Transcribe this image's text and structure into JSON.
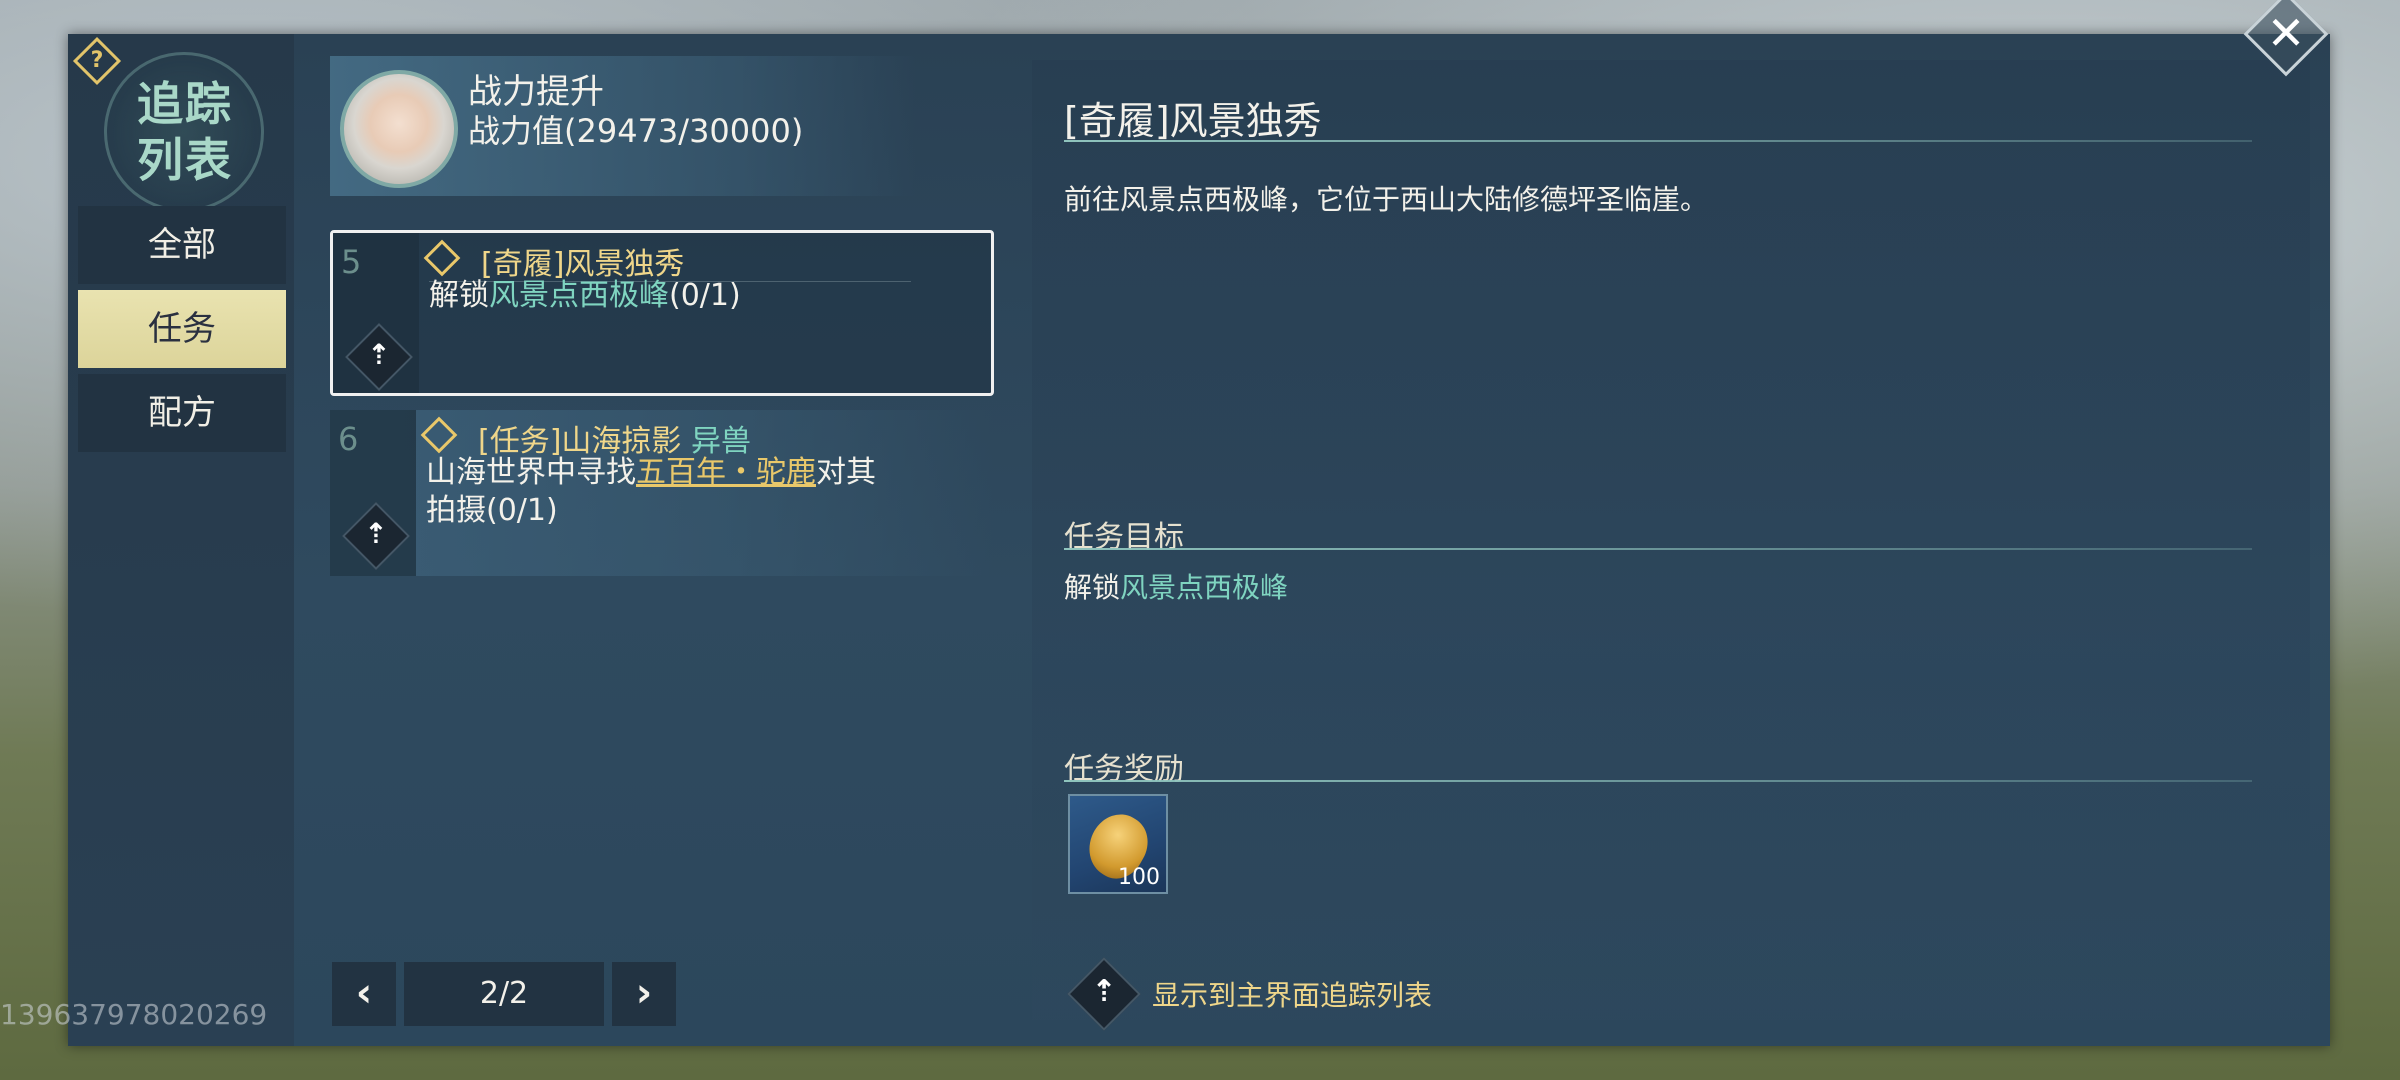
{
  "sidebar": {
    "help_icon": "?",
    "emblem_title": "追踪\n列表",
    "tabs": [
      {
        "label": "全部",
        "active": false
      },
      {
        "label": "任务",
        "active": true
      },
      {
        "label": "配方",
        "active": false
      }
    ]
  },
  "power": {
    "title": "战力提升",
    "value": "战力值(29473/30000)"
  },
  "quests": [
    {
      "num": "5",
      "title_prefix": "[奇履]风景独秀",
      "desc_pre": "解锁",
      "desc_hl": "风景点西极峰",
      "desc_post": "(0/1)",
      "track_icon": "⇡"
    },
    {
      "num": "6",
      "title_prefix": "[任务]山海掠影",
      "title_tag": "异兽",
      "desc_pre": "山海世界中寻找",
      "desc_hl": "五百年・驼鹿",
      "desc_post": "对其拍摄(0/1)",
      "track_icon": "⇡"
    }
  ],
  "pager": {
    "prev": "‹",
    "label": "2/2",
    "next": "›"
  },
  "detail": {
    "title": "[奇履]风景独秀",
    "description": "前往风景点西极峰，它位于西山大陆修德坪圣临崖。",
    "objective_heading": "任务目标",
    "objective_pre": "解锁",
    "objective_hl": "风景点西极峰",
    "reward_heading": "任务奖励",
    "reward_count": "100",
    "track_label": "显示到主界面追踪列表",
    "track_icon": "⇡"
  },
  "close_icon": "✕",
  "watermark": "139637978020269",
  "colors": {
    "highlight_green": "#7fd4c0",
    "highlight_gold": "#e9c86a",
    "active_tab": "#e9e3b0",
    "panel": "#2f4a5f"
  },
  "icons": [
    "help-icon",
    "emblem-icon",
    "quest-diamond-icon",
    "track-arrow-icon",
    "prev-arrow-icon",
    "next-arrow-icon",
    "close-icon",
    "reward-item-icon"
  ]
}
